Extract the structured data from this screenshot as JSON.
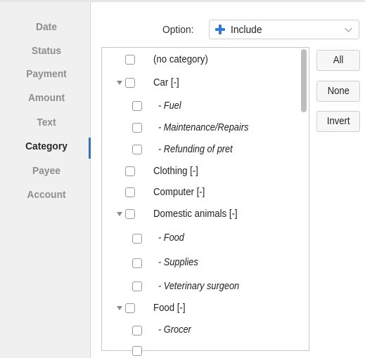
{
  "sidebar": {
    "items": [
      {
        "label": "Date"
      },
      {
        "label": "Status"
      },
      {
        "label": "Payment"
      },
      {
        "label": "Amount"
      },
      {
        "label": "Text"
      },
      {
        "label": "Category"
      },
      {
        "label": "Payee"
      },
      {
        "label": "Account"
      }
    ],
    "active_label": "Category"
  },
  "option": {
    "label": "Option:",
    "value": "Include",
    "icon": "plus-icon"
  },
  "buttons": {
    "all": "All",
    "none": "None",
    "invert": "Invert"
  },
  "categories": [
    {
      "label": "(no category)"
    },
    {
      "label": "Car [-]"
    },
    {
      "label": "- Fuel"
    },
    {
      "label": "- Maintenance/Repairs"
    },
    {
      "label": "- Refunding of pret"
    },
    {
      "label": "Clothing [-]"
    },
    {
      "label": "Computer [-]"
    },
    {
      "label": "Domestic animals [-]"
    },
    {
      "label": "- Food"
    },
    {
      "label": "- Supplies"
    },
    {
      "label": "- Veterinary surgeon"
    },
    {
      "label": "Food [-]"
    },
    {
      "label": "- Grocer"
    }
  ],
  "colors": {
    "accent": "#2f74c0",
    "include_icon": "#2f7bd6"
  }
}
